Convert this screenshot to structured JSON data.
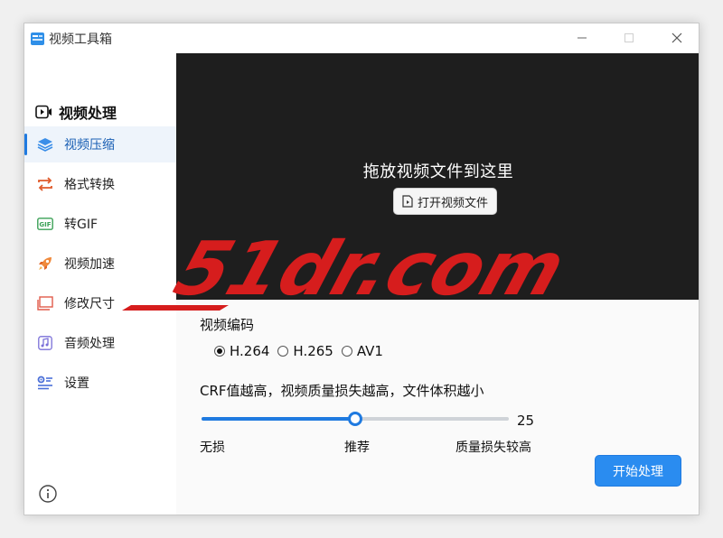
{
  "window": {
    "title": "视频工具箱"
  },
  "sidebar": {
    "header": "视频处理",
    "items": [
      {
        "label": "视频压缩",
        "icon": "layers-icon",
        "active": true
      },
      {
        "label": "格式转换",
        "icon": "convert-arrows-icon",
        "active": false
      },
      {
        "label": "转GIF",
        "icon": "gif-icon",
        "active": false
      },
      {
        "label": "视频加速",
        "icon": "rocket-icon",
        "active": false
      },
      {
        "label": "修改尺寸",
        "icon": "resize-icon",
        "active": false
      },
      {
        "label": "音频处理",
        "icon": "music-note-icon",
        "active": false
      },
      {
        "label": "设置",
        "icon": "settings-sliders-icon",
        "active": false
      }
    ],
    "info_icon": "info-icon"
  },
  "dropzone": {
    "title": "拖放视频文件到这里",
    "open_button": "打开视频文件"
  },
  "encoding": {
    "label": "视频编码",
    "options": [
      "H.264",
      "H.265",
      "AV1"
    ],
    "selected": "H.264"
  },
  "crf": {
    "label": "CRF值越高，视频质量损失越高，文件体积越小",
    "value": "25",
    "fraction": 0.5,
    "tick_left": "无损",
    "tick_middle": "推荐",
    "tick_right": "质量损失较高"
  },
  "actions": {
    "start_button": "开始处理"
  },
  "colors": {
    "accent": "#1f7ae0",
    "dropzone_bg": "#1e1e1e",
    "watermark": "#d61d1d"
  },
  "watermark": {
    "text": "51dr.com"
  }
}
